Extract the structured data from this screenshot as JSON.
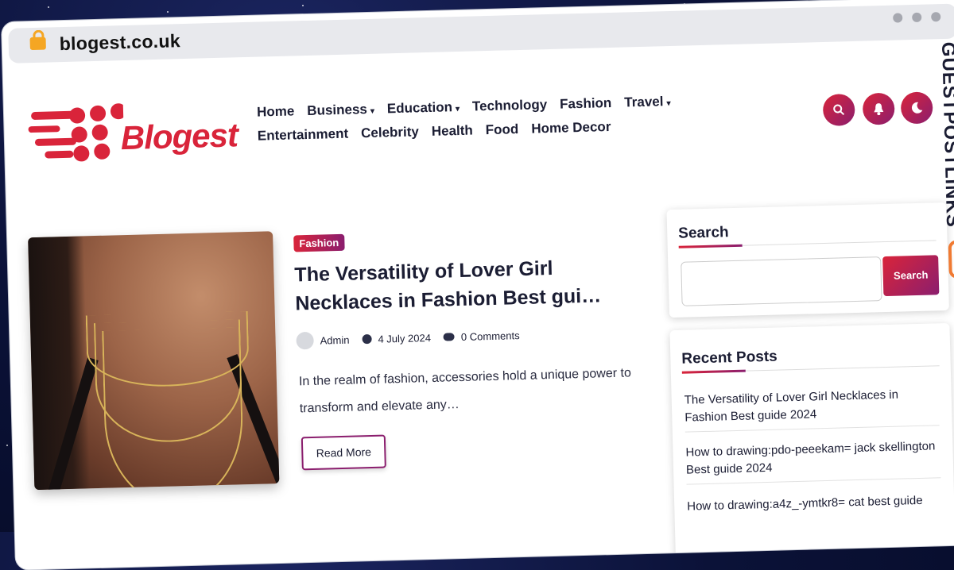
{
  "browser": {
    "url": "blogest.co.uk"
  },
  "header": {
    "logo_text": "Blogest",
    "nav_row1": [
      {
        "label": "Home",
        "has_dropdown": false
      },
      {
        "label": "Business",
        "has_dropdown": true
      },
      {
        "label": "Education",
        "has_dropdown": true
      },
      {
        "label": "Technology",
        "has_dropdown": false
      },
      {
        "label": "Fashion",
        "has_dropdown": false
      },
      {
        "label": "Travel",
        "has_dropdown": true
      }
    ],
    "nav_row2": [
      {
        "label": "Entertainment",
        "has_dropdown": false
      },
      {
        "label": "Celebrity",
        "has_dropdown": false
      },
      {
        "label": "Health",
        "has_dropdown": false
      },
      {
        "label": "Food",
        "has_dropdown": false
      },
      {
        "label": "Home Decor",
        "has_dropdown": false
      }
    ],
    "buttons": {
      "search_icon": "search-icon",
      "bell_icon": "bell-icon",
      "theme_icon": "moon-icon"
    },
    "accent_color": "#d9243a",
    "accent_color2": "#8b1e6e"
  },
  "post": {
    "category": "Fashion",
    "title": "The Versatility of Lover Girl Necklaces in Fashion Best gui…",
    "author": "Admin",
    "date": "4 July 2024",
    "comments": "0 Comments",
    "excerpt": "In the realm of fashion, accessories hold a unique power to transform and elevate any…",
    "read_more": "Read More"
  },
  "sidebar": {
    "search": {
      "heading": "Search",
      "placeholder": "",
      "button": "Search"
    },
    "recent": {
      "heading": "Recent Posts",
      "items": [
        "The Versatility of Lover Girl Necklaces in Fashion Best guide 2024",
        "How to drawing:pdo-peeekam= jack skellington Best guide 2024",
        "How to drawing:a4z_-ymtkr8= cat best guide"
      ]
    }
  },
  "watermark": {
    "text": "GUESTPOSTLINKS"
  }
}
